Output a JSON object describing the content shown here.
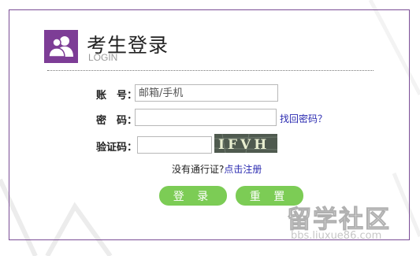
{
  "header": {
    "title": "考生登录",
    "subtitle": "LOGIN",
    "logo_icon": "users-icon",
    "accent_color": "#7d3d96"
  },
  "form": {
    "account_label": "账　号：",
    "account_placeholder": "邮箱/手机",
    "password_label": "密　码：",
    "forgot_link": "找回密码？",
    "captcha_label": "验证码：",
    "captcha_text": "IFVH"
  },
  "register": {
    "prompt": "没有通行证?",
    "link": "点击注册"
  },
  "buttons": {
    "login": "登 录",
    "reset": "重 置",
    "color": "#7ccc55"
  },
  "watermark": {
    "text": "留学社区",
    "url": "bbs.liuxue86.com"
  }
}
